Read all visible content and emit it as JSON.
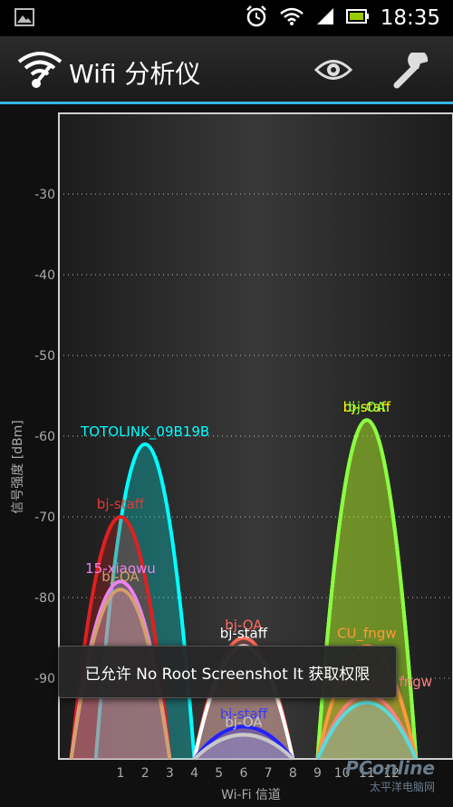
{
  "status_bar": {
    "time": "18:35",
    "icons": [
      "image-notification-icon",
      "alarm-icon",
      "wifi-icon",
      "signal-icon",
      "battery-icon"
    ]
  },
  "app_bar": {
    "title": "Wifi 分析仪",
    "icons": [
      "wifi-analyzer-logo-icon",
      "eye-icon",
      "wrench-icon"
    ],
    "accent": "#33b5e5"
  },
  "toast": {
    "text": "已允许 No Root Screenshot It 获取权限"
  },
  "watermark": {
    "brand": "PConline",
    "sub": "太平洋电脑网"
  },
  "chart_data": {
    "type": "area",
    "xlabel": "Wi-Fi 信道",
    "ylabel": "信号强度 [dBm]",
    "xlim": [
      -1.5,
      14.5
    ],
    "ylim": [
      -100,
      -20
    ],
    "x_ticks": [
      1,
      2,
      3,
      4,
      5,
      6,
      7,
      8,
      9,
      10,
      11,
      12
    ],
    "y_ticks": [
      -30,
      -40,
      -50,
      -60,
      -70,
      -80,
      -90
    ],
    "grid": true,
    "series": [
      {
        "name": "TOTOLINK_09B19B",
        "channel": 2,
        "level": -61,
        "color": "#00ffff",
        "label_color": "#00ffff"
      },
      {
        "name": "bj-staff",
        "channel": 1,
        "level": -70,
        "color": "#e02020",
        "label_color": "#e53935"
      },
      {
        "name": "15-xiaowu",
        "channel": 1,
        "level": -78,
        "color": "#ee82ee",
        "label_color": "#ee82ee"
      },
      {
        "name": "bj-OA",
        "channel": 1,
        "level": -79,
        "color": "#d2a06e",
        "label_color": "#d2a06e"
      },
      {
        "name": "bj-OA",
        "channel": 6,
        "level": -85,
        "color": "#ff6a5a",
        "label_color": "#ff6a5a"
      },
      {
        "name": "bj-staff",
        "channel": 6,
        "level": -86,
        "color": "#ffffff",
        "label_color": "#ffffff"
      },
      {
        "name": "bj-staff",
        "channel": 6,
        "level": -96,
        "color": "#2222ff",
        "label_color": "#3a3aff"
      },
      {
        "name": "bj-OA",
        "channel": 6,
        "level": -97,
        "color": "#c8c8c8",
        "label_color": "#c8c8c8"
      },
      {
        "name": "bj-staff",
        "channel": 11,
        "level": -58,
        "color": "#ffff00",
        "label_color": "#ffff00"
      },
      {
        "name": "bj-OA",
        "channel": 11,
        "level": -58,
        "color": "#88ff44",
        "label_color": "#88ff44"
      },
      {
        "name": "CU_fngw",
        "channel": 11,
        "level": -86,
        "color": "#ff9a3c",
        "label_color": "#ff9a3c"
      },
      {
        "name": "VIDEOPHONE_fngw",
        "channel": 11,
        "level": -92,
        "color": "#ff7f7f",
        "label_color": "#ff7f7f"
      },
      {
        "name": "",
        "channel": 11,
        "level": -93,
        "color": "#55dddd",
        "label_color": "#55dddd"
      }
    ]
  }
}
